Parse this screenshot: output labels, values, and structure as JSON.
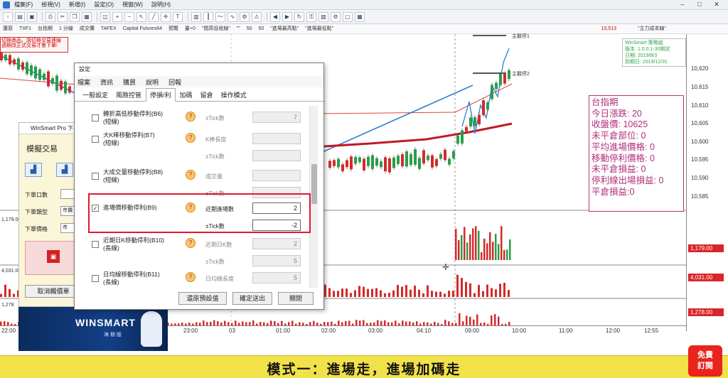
{
  "menubar": {
    "items": [
      "檔案(F)",
      "檢視(V)",
      "新增(I)",
      "設定(O)",
      "視窗(W)",
      "說明(H)"
    ]
  },
  "infobar": {
    "items": [
      "還原",
      "TXF1",
      "台指期",
      "1 分線",
      "成交價",
      "TAFEX",
      "Capital Futures64",
      "預覽",
      "量+0",
      "\"間高低收線\"",
      "\"\"",
      "50",
      "50",
      "\"進場最高點\"",
      "\"進場最低點\""
    ],
    "right_value": "10,513",
    "right_label": "\"主力成本線\""
  },
  "warning": {
    "lines": [
      "切換商品，請切換交易連線",
      "週期改正式交易才會下單!"
    ]
  },
  "version_box": {
    "lines": [
      "WinSmart 策略組",
      "版本: 1.0.0.1-30期試",
      "日期: 2019/8/3",
      "到期日: 2019/12/31"
    ]
  },
  "stats_box": {
    "lines": [
      "台指期",
      "今日漲跌: 20",
      "收盤價: 10625",
      "未平倉部位: 0",
      "平均進場價格: 0",
      "移動停利價格: 0",
      "未平倉損益: 0",
      "停利線出場損益: 0",
      "平倉損益:0"
    ]
  },
  "line_labels": {
    "upper": "主觀停1",
    "lower": "主觀停2"
  },
  "y_axis": {
    "ticks": [
      "10,620",
      "10,615",
      "10,610",
      "10,605",
      "10,600",
      "10,595",
      "10,590",
      "10,585"
    ],
    "badges": [
      "1,179.00",
      "4,031.00",
      "1,278.00"
    ],
    "left_labels": [
      "1,179.00",
      "4,031.00",
      "1,278"
    ]
  },
  "x_axis": {
    "ticks": [
      "22:00",
      "23:00",
      "03",
      "01:00",
      "02:00",
      "03:00",
      "04:10",
      "09:00",
      "10:00",
      "11:00",
      "12:00",
      "12:55"
    ]
  },
  "winsmart_panel": {
    "title": "WinSmart Pro 下單",
    "mode_label": "模擬交易",
    "qty_label": "下單口數",
    "type_label": "下單類型",
    "type_value": "市價",
    "price_label": "下單價格",
    "price_value": "市",
    "cancel_label": "取消觸價單"
  },
  "banner": {
    "title": "WINSMART",
    "subtitle": "海 期 版"
  },
  "dialog": {
    "title": "設定",
    "menu": [
      "檔案",
      "資訊",
      "購買",
      "說明",
      "回報"
    ],
    "tabs": [
      "一般設定",
      "風險控管",
      "停損/利",
      "加碼",
      "留倉",
      "操作模式"
    ],
    "active_tab": "停損/利",
    "rows": [
      {
        "checked": false,
        "label": "轉折高低移動停利(B6)\n(短線)",
        "param": "±Tick數",
        "value": "7",
        "enabled": false
      },
      {
        "checked": false,
        "label": "大K棒移動停利(B7)\n(短線)",
        "param": "K棒長度",
        "value": "",
        "enabled": false
      },
      {
        "checked": false,
        "label": "",
        "param": "±Tick數",
        "value": "",
        "enabled": false
      },
      {
        "checked": false,
        "label": "大成交量移動停利(B8)\n(短線)",
        "param": "成交量",
        "value": "",
        "enabled": false
      },
      {
        "checked": false,
        "label": "",
        "param": "±Tick數",
        "value": "",
        "enabled": false
      },
      {
        "checked": true,
        "label": "進場價移動停利(B9)",
        "param": "近期進場數",
        "value": "2",
        "enabled": true
      },
      {
        "checked": true,
        "label": "",
        "param": "±Tick數",
        "value": "-2",
        "enabled": true
      },
      {
        "checked": false,
        "label": "近期日K移動停利(B10)\n(長線)",
        "param": "近期日K數",
        "value": "2",
        "enabled": false
      },
      {
        "checked": false,
        "label": "",
        "param": "±Tick數",
        "value": "5",
        "enabled": false
      },
      {
        "checked": false,
        "label": "日均線移動停利(B11)\n(長線)",
        "param": "日均線長度",
        "value": "5",
        "enabled": false
      }
    ],
    "buttons": {
      "reset": "還原預設值",
      "ok": "確定送出",
      "close": "關閉"
    }
  },
  "caption": "模式一：進場走，進場加碼走",
  "subscribe": {
    "line1": "免費",
    "line2": "訂閱"
  },
  "colors": {
    "accent_red": "#e0182d",
    "stats": "#b02f7a",
    "caption_bg": "#f2e24a"
  }
}
